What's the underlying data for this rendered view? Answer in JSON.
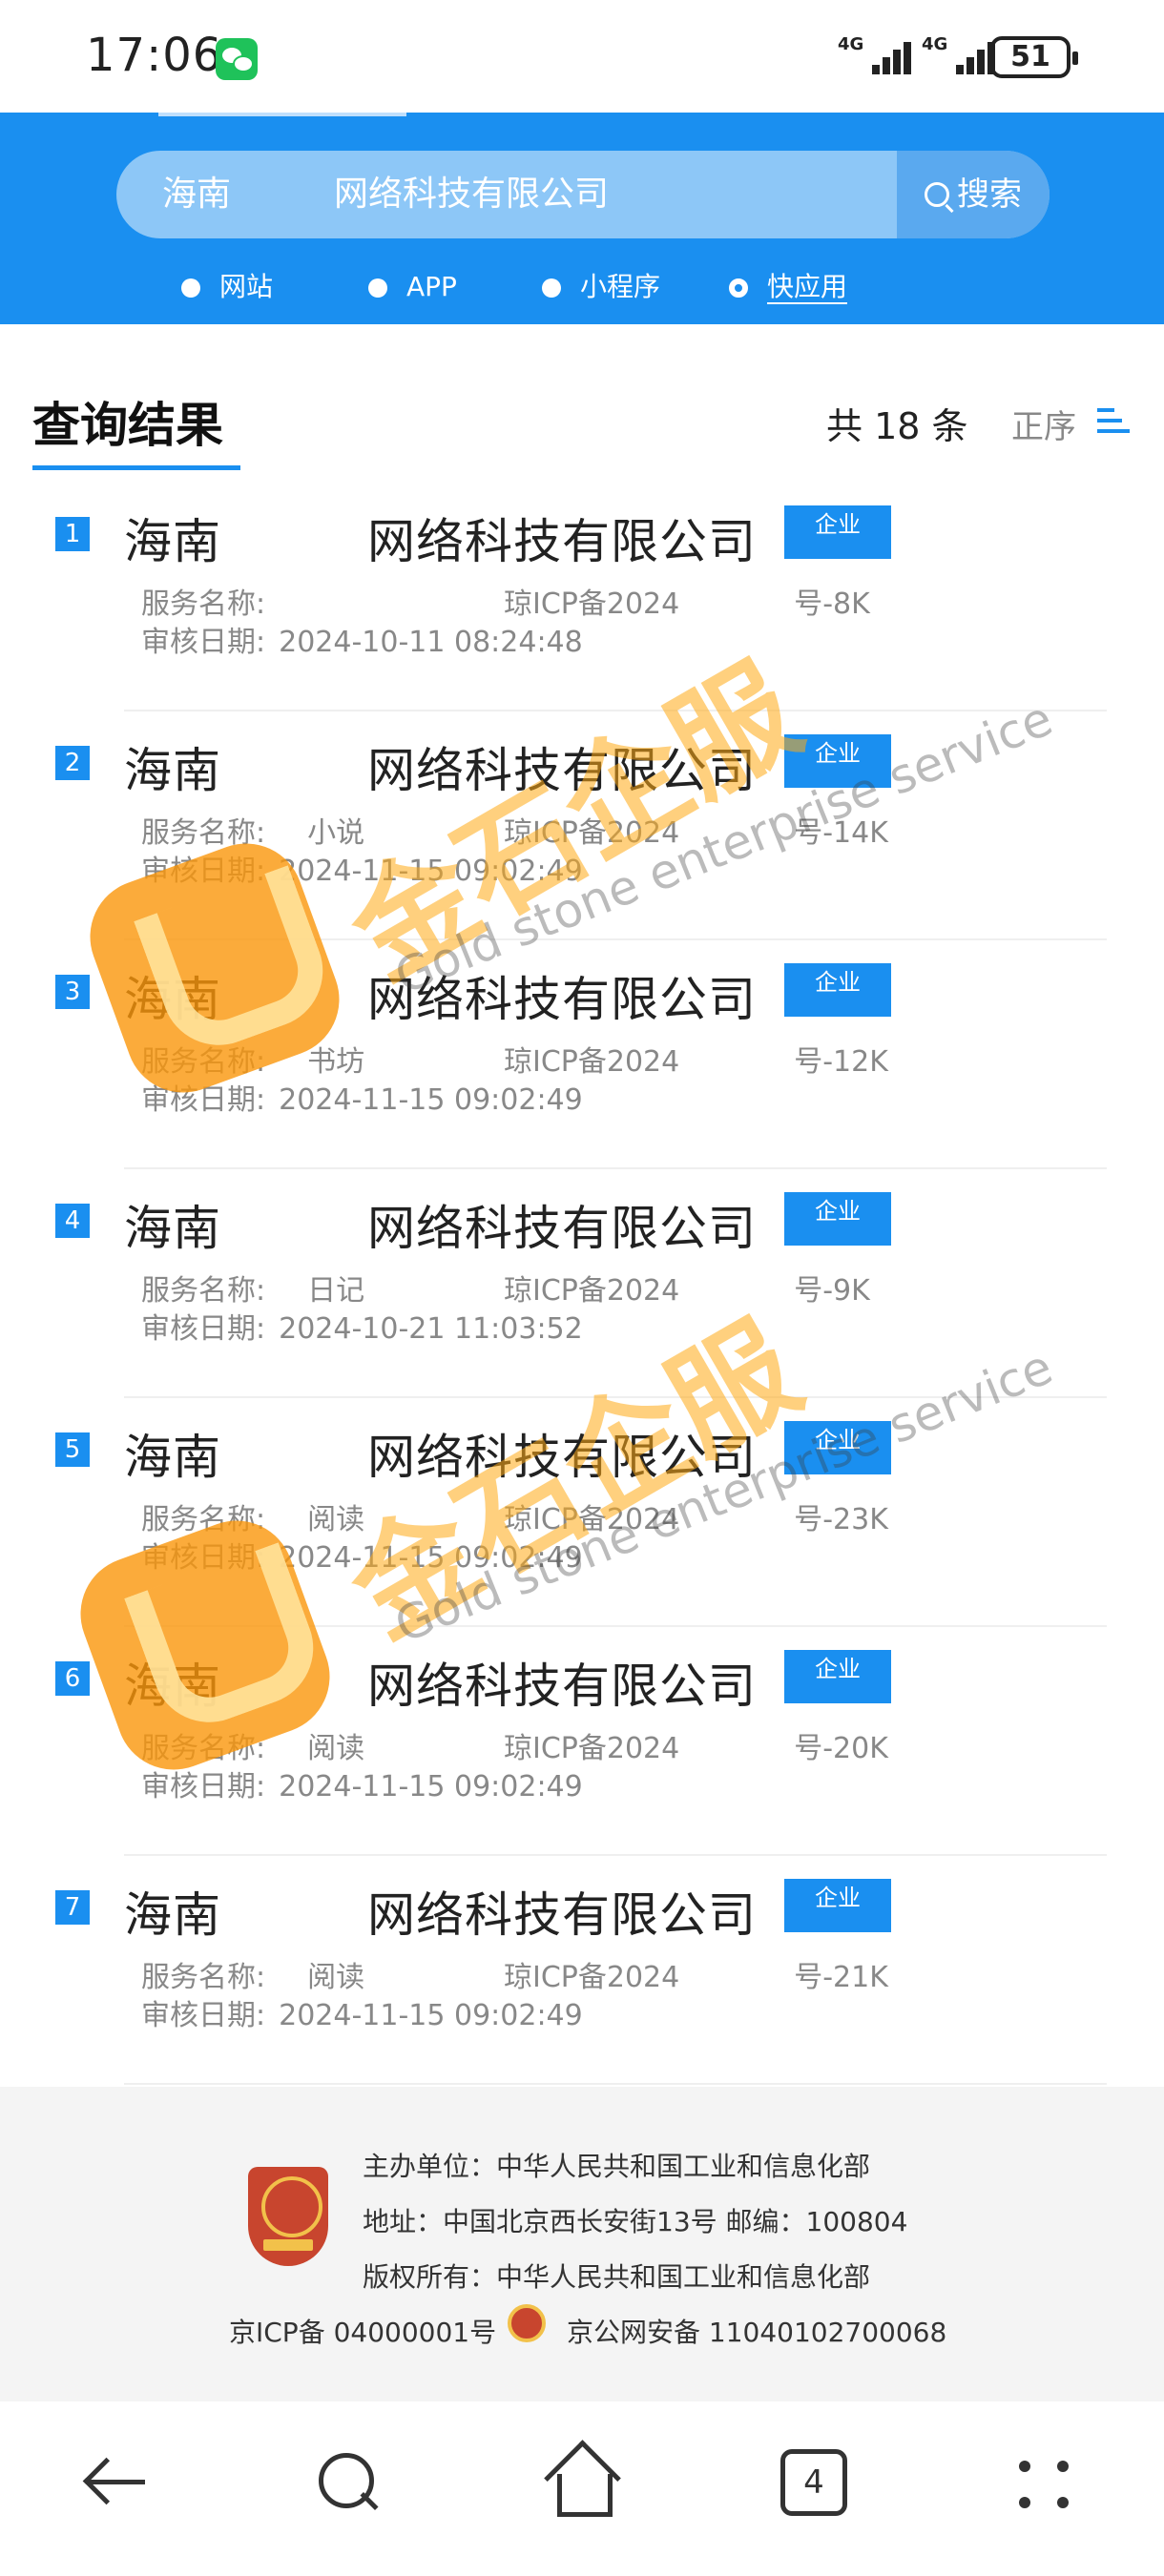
{
  "status_bar": {
    "time": "17:06",
    "network1": "4G",
    "network2": "4G",
    "battery": "51"
  },
  "search": {
    "query": "海南　　　网络科技有限公司",
    "button_label": "搜索"
  },
  "type_options": [
    {
      "label": "网站",
      "selected": false
    },
    {
      "label": "APP",
      "selected": false
    },
    {
      "label": "小程序",
      "selected": false
    },
    {
      "label": "快应用",
      "selected": true
    }
  ],
  "results": {
    "title": "查询结果",
    "count_text": "共 18 条",
    "sort_label": "正序",
    "service_key": "服务名称:",
    "date_key": "审核日期:",
    "items": [
      {
        "num": "1",
        "name": "海南　　　网络科技有限公司",
        "badge": "企业",
        "service": "　　　",
        "icp": "琼ICP备2024　　　　号-8K",
        "date": "2024-10-11 08:24:48"
      },
      {
        "num": "2",
        "name": "海南　　　网络科技有限公司",
        "badge": "企业",
        "service": "　小说",
        "icp": "琼ICP备2024　　　　号-14K",
        "date": "2024-11-15 09:02:49"
      },
      {
        "num": "3",
        "name": "海南　　　网络科技有限公司",
        "badge": "企业",
        "service": "　书坊",
        "icp": "琼ICP备2024　　　　号-12K",
        "date": "2024-11-15 09:02:49"
      },
      {
        "num": "4",
        "name": "海南　　　网络科技有限公司",
        "badge": "企业",
        "service": "　日记",
        "icp": "琼ICP备2024　　　　号-9K",
        "date": "2024-10-21 11:03:52"
      },
      {
        "num": "5",
        "name": "海南　　　网络科技有限公司",
        "badge": "企业",
        "service": "　阅读",
        "icp": "琼ICP备2024　　　　号-23K",
        "date": "2024-11-15 09:02:49"
      },
      {
        "num": "6",
        "name": "海南　　　网络科技有限公司",
        "badge": "企业",
        "service": "　阅读",
        "icp": "琼ICP备2024　　　　号-20K",
        "date": "2024-11-15 09:02:49"
      },
      {
        "num": "7",
        "name": "海南　　　网络科技有限公司",
        "badge": "企业",
        "service": "　阅读",
        "icp": "琼ICP备2024　　　　号-21K",
        "date": "2024-11-15 09:02:49"
      }
    ]
  },
  "watermark": {
    "cn": "金石企服",
    "en": "Gold stone enterprise service"
  },
  "footer": {
    "sponsor": "主办单位：中华人民共和国工业和信息化部",
    "address": "地址：中国北京西长安街13号 邮编：100804",
    "copyright": "版权所有：中华人民共和国工业和信息化部",
    "icp": "京ICP备 04000001号",
    "police": "京公网安备 11040102700068"
  },
  "nav": {
    "tab_count": "4"
  },
  "colors": {
    "brand_blue": "#1a8ff0",
    "watermark_orange": "#ffaa14"
  }
}
